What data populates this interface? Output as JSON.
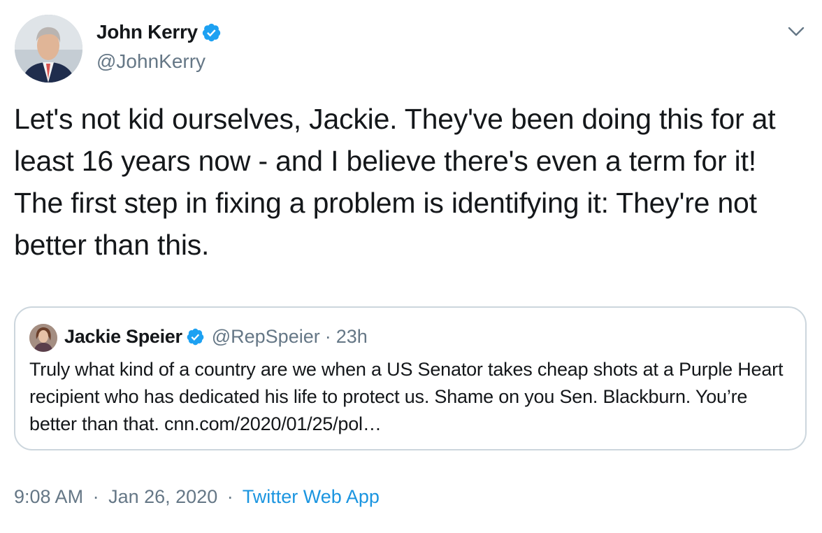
{
  "author": {
    "name": "John Kerry",
    "handle": "@JohnKerry",
    "verified_icon": "verified-badge-icon",
    "avatar_icon": "avatar-icon"
  },
  "menu_icon": "chevron-down-icon",
  "tweet": {
    "text": "Let's not kid ourselves, Jackie. They've been doing this for at least 16 years now - and I believe there's even a term for it!  The first step in fixing a problem is identifying it: They're not better than this."
  },
  "quoted": {
    "name": "Jackie Speier",
    "handle": "@RepSpeier",
    "separator": "·",
    "time": "23h",
    "text": "Truly what kind of a country are we when a US Senator takes cheap shots at a Purple Heart recipient who has dedicated his life to protect us. Shame on you Sen. Blackburn. You’re better than that. cnn.com/2020/01/25/pol…"
  },
  "footer": {
    "time": "9:08 AM",
    "separator_1": "·",
    "date": "Jan 26, 2020",
    "separator_2": "·",
    "source": "Twitter Web App"
  },
  "colors": {
    "text": "#14171a",
    "secondary": "#657786",
    "link": "#1b95e0",
    "verified": "#1da1f2",
    "border": "#ccd6dd"
  }
}
